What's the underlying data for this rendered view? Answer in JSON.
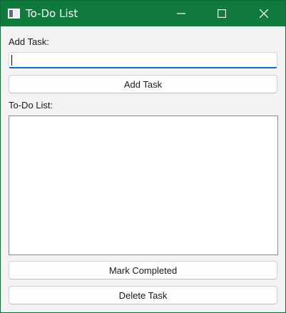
{
  "window": {
    "title": "To-Do List",
    "accent_color": "#0f7a3b",
    "icons": {
      "app": "app-window-icon",
      "minimize": "minimize-icon",
      "maximize": "maximize-icon",
      "close": "close-icon"
    }
  },
  "form": {
    "add_task_label": "Add Task:",
    "task_input_value": "",
    "add_button_label": "Add Task",
    "list_label": "To-Do List:",
    "items": []
  },
  "actions": {
    "mark_completed_label": "Mark Completed",
    "delete_task_label": "Delete Task"
  }
}
